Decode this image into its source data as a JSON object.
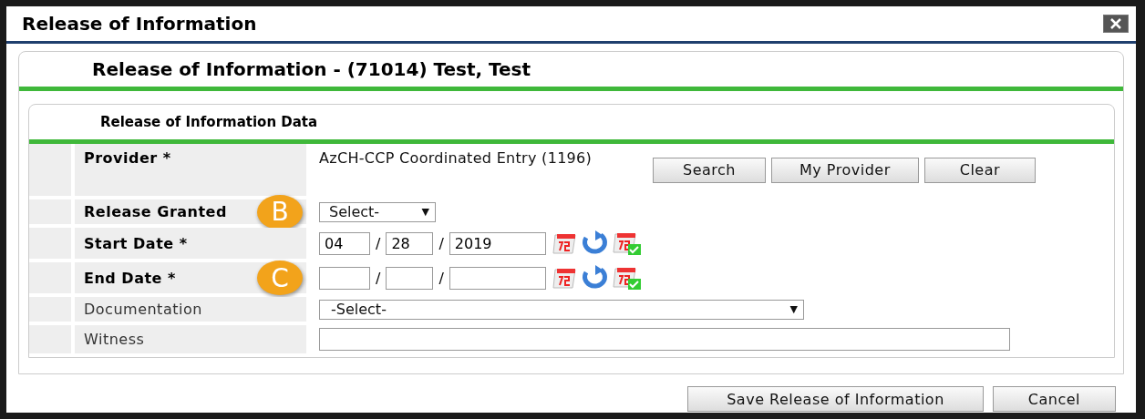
{
  "window": {
    "title": "Release of Information"
  },
  "panel": {
    "title": "Release of Information - (71014) Test, Test"
  },
  "section": {
    "title": "Release of Information Data"
  },
  "rows": [
    {
      "kind": "provider",
      "label": "Provider",
      "marker": "*",
      "value": "AzCH-CCP Coordinated Entry (1196)",
      "buttons": [
        "Search",
        "My Provider",
        "Clear"
      ]
    },
    {
      "kind": "select",
      "label": "Release Granted",
      "value": "Select-",
      "arrow": "▼",
      "callout": "B"
    },
    {
      "kind": "date",
      "label": "Start Date",
      "marker": "*",
      "month": "04",
      "day": "28",
      "year": "2019",
      "separators": [
        "/",
        "/"
      ]
    },
    {
      "kind": "date",
      "label": "End Date",
      "marker": "*",
      "month": "",
      "day": "",
      "year": "",
      "separators": [
        "/",
        "/"
      ],
      "callout": "C"
    },
    {
      "kind": "dropdown",
      "label": "Documentation",
      "value": "-Select-",
      "arrow": "▼"
    },
    {
      "kind": "text",
      "label": "Witness"
    }
  ],
  "buttons": [
    "Save Release of Information",
    "Cancel"
  ]
}
